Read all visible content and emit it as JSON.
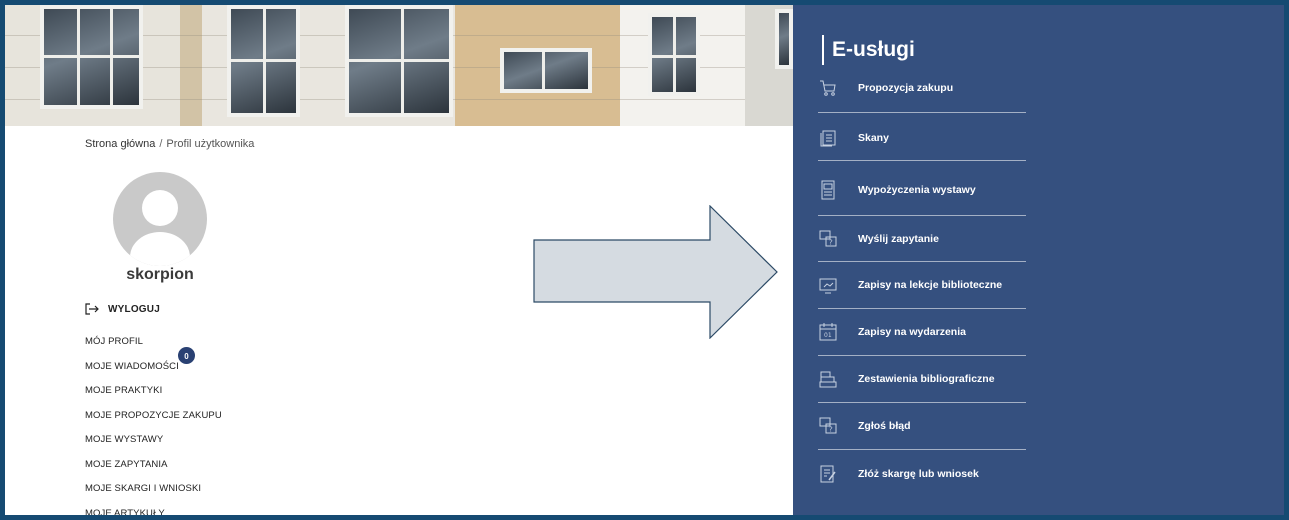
{
  "breadcrumb": {
    "home": "Strona główna",
    "separator": "/",
    "current": "Profil użytkownika"
  },
  "profile": {
    "username": "skorpion",
    "logout_label": "WYLOGUJ"
  },
  "menu": {
    "items": [
      "MÓJ PROFIL",
      "MOJE WIADOMOŚCI",
      "MOJE PRAKTYKI",
      "MOJE PROPOZYCJE ZAKUPU",
      "MOJE WYSTAWY",
      "MOJE ZAPYTANIA",
      "MOJE SKARGI I WNIOSKI",
      "MOJE ARTYKUŁY"
    ],
    "messages_badge": "0"
  },
  "eservices": {
    "title": "E-usługi",
    "items": [
      {
        "label": "Propozycja zakupu",
        "icon": "cart-icon"
      },
      {
        "label": "Skany",
        "icon": "pages-icon"
      },
      {
        "label": "Wypożyczenia wystawy",
        "icon": "easel-icon"
      },
      {
        "label": "Wyślij zapytanie",
        "icon": "question-chat-icon"
      },
      {
        "label": "Zapisy na lekcje biblioteczne",
        "icon": "screen-icon"
      },
      {
        "label": "Zapisy na wydarzenia",
        "icon": "calendar-icon"
      },
      {
        "label": "Zestawienia bibliograficzne",
        "icon": "books-icon"
      },
      {
        "label": "Zgłoś błąd",
        "icon": "question-chat-icon"
      },
      {
        "label": "Złóż skargę lub wniosek",
        "icon": "document-edit-icon"
      }
    ]
  },
  "colors": {
    "panel": "#35507f",
    "frame": "#154a72",
    "badge": "#2a4173",
    "arrow_fill": "#d5dbe1",
    "arrow_stroke": "#2c4a66"
  }
}
